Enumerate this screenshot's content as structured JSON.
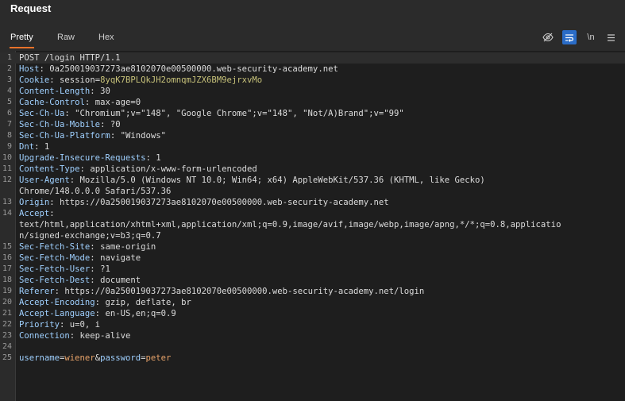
{
  "panel": {
    "title": "Request"
  },
  "tabs": [
    {
      "label": "Pretty",
      "active": true
    },
    {
      "label": "Raw",
      "active": false
    },
    {
      "label": "Hex",
      "active": false
    }
  ],
  "toolbar": {
    "newline_label": "\\n",
    "icons": [
      "eye-off-icon",
      "word-wrap-icon",
      "newline-icon",
      "menu-icon"
    ]
  },
  "colors": {
    "active_tab_underline": "#e8722a",
    "active_tool_bg": "#2a6cc7"
  },
  "request": {
    "request_line": "POST /login HTTP/1.1",
    "headers": [
      {
        "ln": "2",
        "name": "Host",
        "value": "0a250019037273ae8102070e00500000.web-security-academy.net"
      },
      {
        "ln": "3",
        "name": "Cookie",
        "cookie_name": "session",
        "cookie_value": "8yqK7BPLQkJH2omnqmJZX6BM9ejrxvMo"
      },
      {
        "ln": "4",
        "name": "Content-Length",
        "value": "30"
      },
      {
        "ln": "5",
        "name": "Cache-Control",
        "value": "max-age=0"
      },
      {
        "ln": "6",
        "name": "Sec-Ch-Ua",
        "value": "\"Chromium\";v=\"148\", \"Google Chrome\";v=\"148\", \"Not/A)Brand\";v=\"99\""
      },
      {
        "ln": "7",
        "name": "Sec-Ch-Ua-Mobile",
        "value": "?0"
      },
      {
        "ln": "8",
        "name": "Sec-Ch-Ua-Platform",
        "value": "\"Windows\""
      },
      {
        "ln": "9",
        "name": "Dnt",
        "value": "1"
      },
      {
        "ln": "10",
        "name": "Upgrade-Insecure-Requests",
        "value": "1"
      },
      {
        "ln": "11",
        "name": "Content-Type",
        "value": "application/x-www-form-urlencoded"
      },
      {
        "ln": "12",
        "name": "User-Agent",
        "value": "Mozilla/5.0 (Windows NT 10.0; Win64; x64) AppleWebKit/537.36 (KHTML, like Gecko)",
        "cont": "Chrome/148.0.0.0 Safari/537.36"
      },
      {
        "ln": "13",
        "name": "Origin",
        "value": "https://0a250019037273ae8102070e00500000.web-security-academy.net"
      },
      {
        "ln": "14",
        "name": "Accept",
        "value": "",
        "cont": "text/html,application/xhtml+xml,application/xml;q=0.9,image/avif,image/webp,image/apng,*/*;q=0.8,applicatio",
        "cont2": "n/signed-exchange;v=b3;q=0.7"
      },
      {
        "ln": "15",
        "name": "Sec-Fetch-Site",
        "value": "same-origin"
      },
      {
        "ln": "16",
        "name": "Sec-Fetch-Mode",
        "value": "navigate"
      },
      {
        "ln": "17",
        "name": "Sec-Fetch-User",
        "value": "?1"
      },
      {
        "ln": "18",
        "name": "Sec-Fetch-Dest",
        "value": "document"
      },
      {
        "ln": "19",
        "name": "Referer",
        "value": "https://0a250019037273ae8102070e00500000.web-security-academy.net/login"
      },
      {
        "ln": "20",
        "name": "Accept-Encoding",
        "value": "gzip, deflate, br"
      },
      {
        "ln": "21",
        "name": "Accept-Language",
        "value": "en-US,en;q=0.9"
      },
      {
        "ln": "22",
        "name": "Priority",
        "value": "u=0, i"
      },
      {
        "ln": "23",
        "name": "Connection",
        "value": "keep-alive"
      }
    ],
    "body": {
      "ln": "25",
      "params": [
        {
          "name": "username",
          "value": "wiener"
        },
        {
          "name": "password",
          "value": "peter"
        }
      ]
    }
  }
}
